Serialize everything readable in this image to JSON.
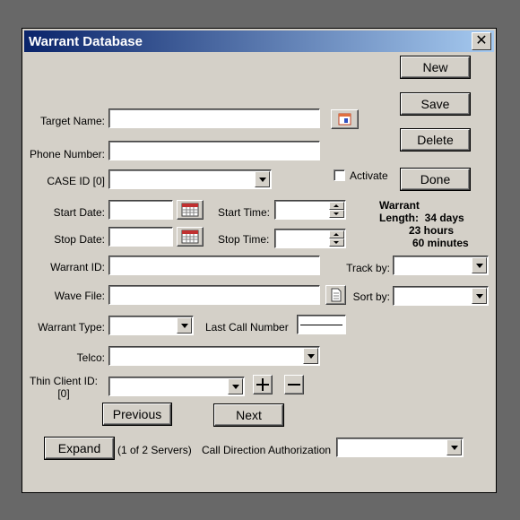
{
  "window": {
    "title": "Warrant Database",
    "close_glyph": "✕"
  },
  "buttons": {
    "new": "New",
    "save": "Save",
    "delete": "Delete",
    "done": "Done",
    "previous": "Previous",
    "next": "Next",
    "expand": "Expand"
  },
  "labels": {
    "target_name": "Target Name:",
    "phone_number": "Phone Number:",
    "case_id": "CASE ID [0]",
    "activate": "Activate",
    "start_date": "Start Date:",
    "start_time": "Start Time:",
    "stop_date": "Stop Date:",
    "stop_time": "Stop Time:",
    "warrant_id": "Warrant ID:",
    "track_by": "Track by:",
    "wave_file": "Wave File:",
    "sort_by": "Sort by:",
    "warrant_type": "Warrant Type:",
    "last_call_number": "Last Call Number",
    "telco": "Telco:",
    "thin_client_line1": "Thin Client ID:",
    "thin_client_line2": "[0]",
    "servers": "(1 of 2 Servers)",
    "call_direction": "Call Direction Authorization"
  },
  "warrant_length": {
    "title": "Warrant",
    "length_label": "Length:",
    "days": "34 days",
    "hours": "23 hours",
    "minutes": "60 minutes"
  },
  "fields": {
    "target_name": "",
    "phone_number": "",
    "case_id": "",
    "start_date": "",
    "start_time": "",
    "stop_date": "",
    "stop_time": "",
    "warrant_id": "",
    "track_by": "",
    "wave_file": "",
    "sort_by": "",
    "warrant_type": "",
    "last_call_number": "",
    "telco": "",
    "thin_client_id": "",
    "call_direction": ""
  },
  "activate_checked": false,
  "icons": {
    "address_book": "address-book-icon",
    "calendar": "calendar-icon",
    "document": "document-icon",
    "plus": "plus-icon",
    "minus": "minus-icon"
  }
}
